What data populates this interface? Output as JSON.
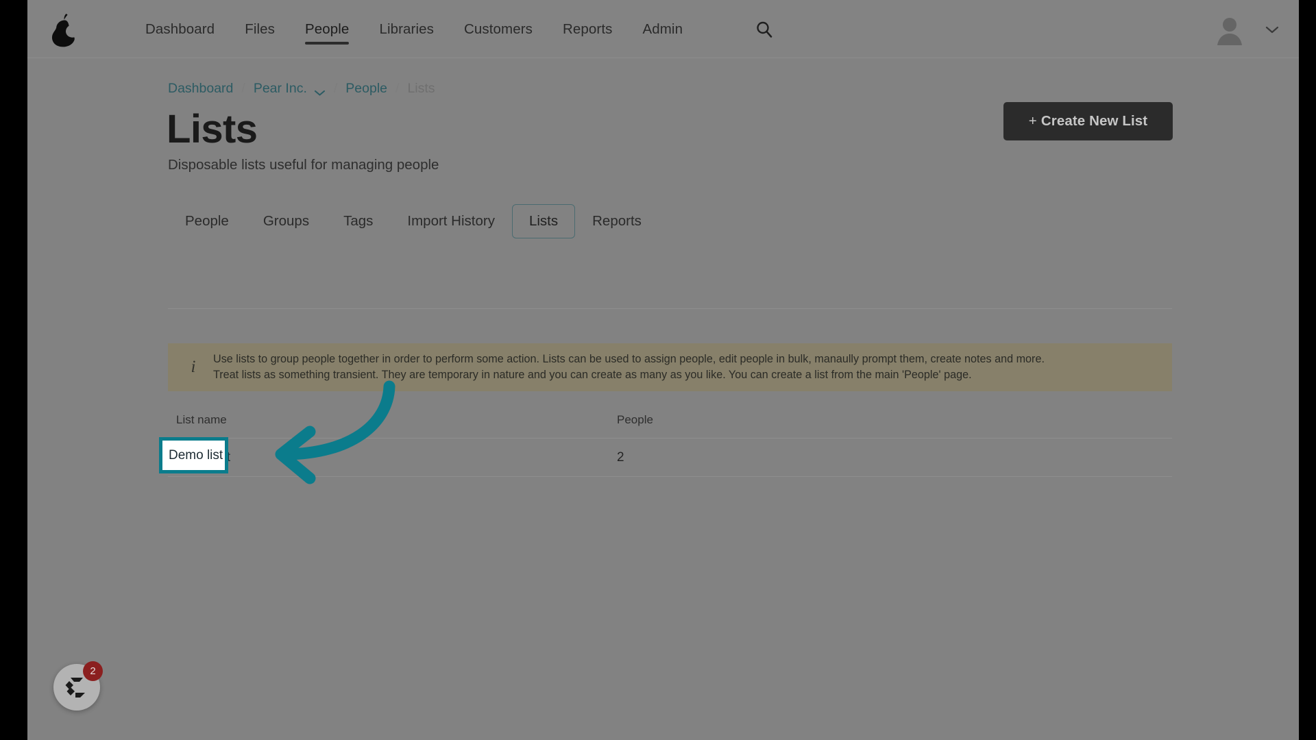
{
  "brand": {
    "logo_icon": "pear-logo-icon"
  },
  "nav": {
    "items": [
      {
        "label": "Dashboard",
        "active": false
      },
      {
        "label": "Files",
        "active": false
      },
      {
        "label": "People",
        "active": true
      },
      {
        "label": "Libraries",
        "active": false
      },
      {
        "label": "Customers",
        "active": false
      },
      {
        "label": "Reports",
        "active": false
      },
      {
        "label": "Admin",
        "active": false
      }
    ],
    "search_icon": "search-icon",
    "avatar_icon": "user-avatar-icon",
    "user_caret_icon": "chevron-down-icon"
  },
  "breadcrumb": {
    "items": [
      {
        "label": "Dashboard",
        "type": "link"
      },
      {
        "label": "Pear Inc.",
        "type": "link",
        "caret": true
      },
      {
        "label": "People",
        "type": "link"
      },
      {
        "label": "Lists",
        "type": "current"
      }
    ],
    "separator": "/"
  },
  "header": {
    "title": "Lists",
    "subtitle": "Disposable lists useful for managing people",
    "create_button": {
      "plus": "+",
      "label": "Create New List"
    }
  },
  "tabs": [
    {
      "label": "People",
      "active": false
    },
    {
      "label": "Groups",
      "active": false
    },
    {
      "label": "Tags",
      "active": false
    },
    {
      "label": "Import History",
      "active": false
    },
    {
      "label": "Lists",
      "active": true
    },
    {
      "label": "Reports",
      "active": false
    }
  ],
  "info_banner": {
    "icon": "info-icon",
    "line1": "Use lists to group people together in order to perform some action. Lists can be used to assign people, edit people in bulk, manaully prompt them, create notes and more.",
    "line2": "Treat lists as something transient. They are temporary in nature and you can create as many as you like. You can create a list from the main 'People' page."
  },
  "table": {
    "columns": [
      "List name",
      "People"
    ],
    "rows": [
      {
        "name": "Demo list",
        "people": "2"
      }
    ]
  },
  "annotation": {
    "arrow_color": "#0b7c8c",
    "highlight_target": "Demo list"
  },
  "chat_widget": {
    "icon": "chat-logo-icon",
    "badge_count": "2"
  },
  "colors": {
    "page_background": "#828282",
    "nav_background": "#838383",
    "banner_background": "#87806a",
    "primary_button": "#2b2b2b",
    "link": "#2c5b63",
    "accent_teal": "#0b7c8c",
    "badge_red": "#8b1f1f"
  }
}
